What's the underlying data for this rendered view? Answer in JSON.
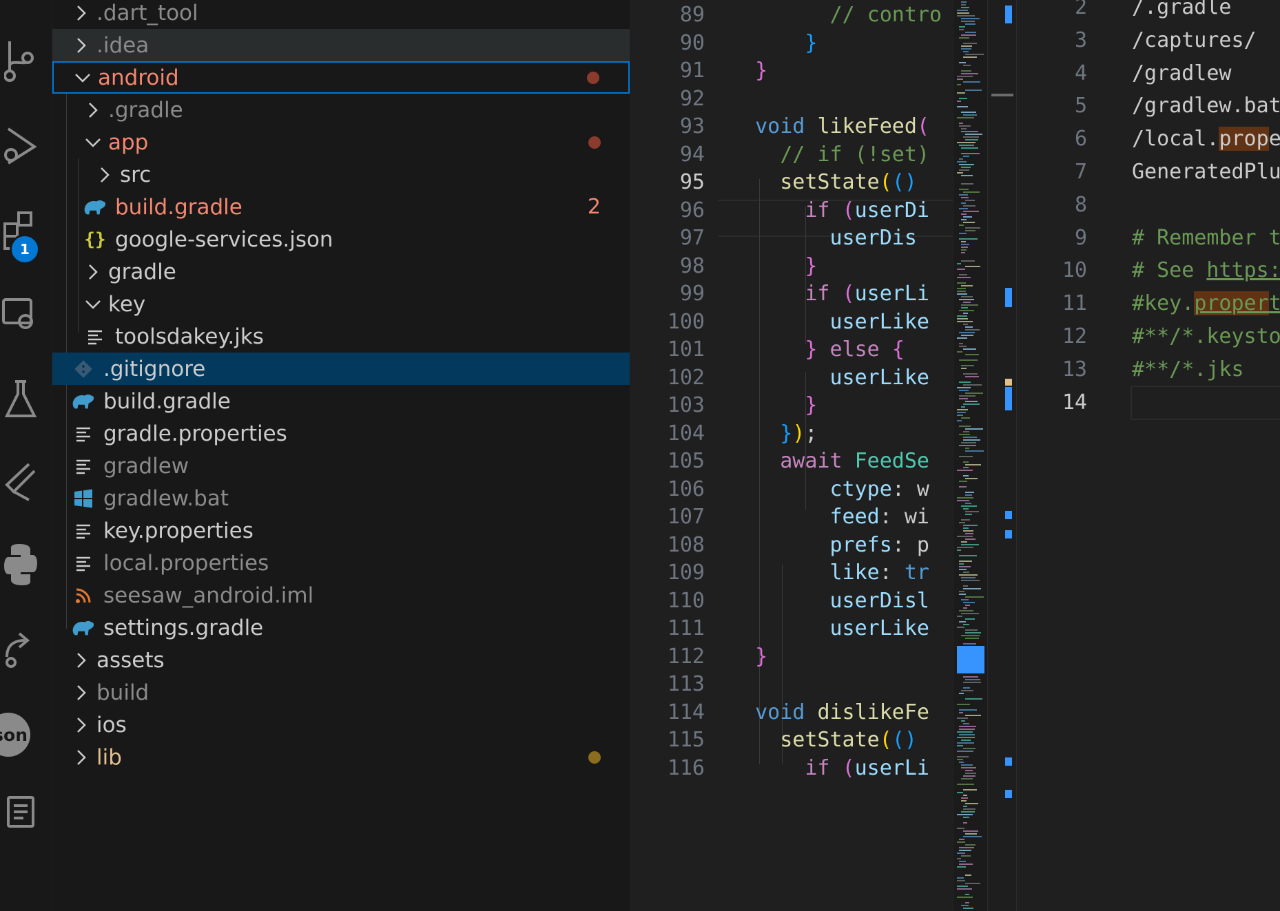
{
  "activity_bar": {
    "extensions_badge": "1",
    "json_badge": "son",
    "icons": [
      "source-control-icon",
      "run-debug-icon",
      "extensions-icon",
      "remote-explorer-icon",
      "testing-icon",
      "flutter-icon",
      "python-icon",
      "json-icon",
      "live-share-icon",
      "output-icon"
    ]
  },
  "explorer": {
    "items": [
      {
        "label": ".dart_tool",
        "chevron": "right",
        "style": "dim"
      },
      {
        "label": ".idea",
        "chevron": "right",
        "style": "dim"
      },
      {
        "label": "android",
        "chevron": "down",
        "style": "mod",
        "decoration": "dot"
      },
      {
        "label": ".gradle",
        "chevron": "right",
        "style": "dim"
      },
      {
        "label": "app",
        "chevron": "down",
        "style": "mod",
        "decoration": "dot"
      },
      {
        "label": "src",
        "chevron": "right",
        "style": "normal"
      },
      {
        "label": "build.gradle",
        "icon": "gradle-elephant-icon",
        "style": "mod",
        "decoration": "2"
      },
      {
        "label": "google-services.json",
        "icon": "json-braces-icon",
        "style": "normal"
      },
      {
        "label": "gradle",
        "chevron": "right",
        "style": "normal"
      },
      {
        "label": "key",
        "chevron": "down",
        "style": "normal"
      },
      {
        "label": "toolsdakey.jks",
        "icon": "lines-file-icon",
        "style": "normal"
      },
      {
        "label": ".gitignore",
        "icon": "git-icon",
        "style": "normal",
        "selected": true
      },
      {
        "label": "build.gradle",
        "icon": "gradle-elephant-icon",
        "style": "normal"
      },
      {
        "label": "gradle.properties",
        "icon": "lines-file-icon",
        "style": "normal"
      },
      {
        "label": "gradlew",
        "icon": "lines-file-icon",
        "style": "dim"
      },
      {
        "label": "gradlew.bat",
        "icon": "windows-icon",
        "style": "dim"
      },
      {
        "label": "key.properties",
        "icon": "lines-file-icon",
        "style": "normal"
      },
      {
        "label": "local.properties",
        "icon": "lines-file-icon",
        "style": "dim"
      },
      {
        "label": "seesaw_android.iml",
        "icon": "rss-icon",
        "style": "dim"
      },
      {
        "label": "settings.gradle",
        "icon": "gradle-elephant-icon",
        "style": "normal"
      },
      {
        "label": "assets",
        "chevron": "right",
        "style": "normal"
      },
      {
        "label": "build",
        "chevron": "right",
        "style": "dim"
      },
      {
        "label": "ios",
        "chevron": "right",
        "style": "normal"
      },
      {
        "label": "lib",
        "chevron": "right",
        "style": "yel",
        "decoration": "dot"
      }
    ]
  },
  "editor": {
    "line_numbers": [
      "89",
      "90",
      "91",
      "92",
      "93",
      "94",
      "95",
      "96",
      "97",
      "98",
      "99",
      "100",
      "101",
      "102",
      "103",
      "104",
      "105",
      "106",
      "107",
      "108",
      "109",
      "110",
      "111",
      "112",
      "113",
      "114",
      "115",
      "116"
    ],
    "current_line": "95",
    "lines": [
      [
        {
          "t": "        // contro",
          "c": "#6a9955"
        }
      ],
      [
        {
          "t": "      }",
          "c": "#179fff"
        }
      ],
      [
        {
          "t": "  }",
          "c": "#da70d6"
        }
      ],
      [
        {
          "t": "",
          "c": "#cccccc"
        }
      ],
      [
        {
          "t": "  void ",
          "c": "#569cd6"
        },
        {
          "t": "likeFeed",
          "c": "#dcdcaa"
        },
        {
          "t": "(",
          "c": "#da70d6"
        }
      ],
      [
        {
          "t": "    // if (!set",
          "c": "#6a9955"
        },
        {
          "t": ")",
          "c": "#6a9955"
        }
      ],
      [
        {
          "t": "    ",
          "c": "#cccccc"
        },
        {
          "t": "setState",
          "c": "#dcdcaa"
        },
        {
          "t": "(",
          "c": "#ffd700"
        },
        {
          "t": "()",
          "c": "#179fff"
        }
      ],
      [
        {
          "t": "      ",
          "c": "#cccccc"
        },
        {
          "t": "if ",
          "c": "#c586c0"
        },
        {
          "t": "(",
          "c": "#da70d6"
        },
        {
          "t": "userDi",
          "c": "#9cdcfe"
        }
      ],
      [
        {
          "t": "        ",
          "c": "#cccccc"
        },
        {
          "t": "userDis",
          "c": "#9cdcfe"
        }
      ],
      [
        {
          "t": "      }",
          "c": "#da70d6"
        }
      ],
      [
        {
          "t": "      ",
          "c": "#cccccc"
        },
        {
          "t": "if ",
          "c": "#c586c0"
        },
        {
          "t": "(",
          "c": "#da70d6"
        },
        {
          "t": "userLi",
          "c": "#9cdcfe"
        }
      ],
      [
        {
          "t": "        ",
          "c": "#cccccc"
        },
        {
          "t": "userLike",
          "c": "#9cdcfe"
        }
      ],
      [
        {
          "t": "      } ",
          "c": "#da70d6"
        },
        {
          "t": "else ",
          "c": "#c586c0"
        },
        {
          "t": "{",
          "c": "#da70d6"
        }
      ],
      [
        {
          "t": "        ",
          "c": "#cccccc"
        },
        {
          "t": "userLike",
          "c": "#9cdcfe"
        }
      ],
      [
        {
          "t": "      }",
          "c": "#da70d6"
        }
      ],
      [
        {
          "t": "    }",
          "c": "#179fff"
        },
        {
          "t": ")",
          "c": "#ffd700"
        },
        {
          "t": ";",
          "c": "#cccccc"
        }
      ],
      [
        {
          "t": "    ",
          "c": "#cccccc"
        },
        {
          "t": "await ",
          "c": "#c586c0"
        },
        {
          "t": "FeedSe",
          "c": "#4ec9b0"
        }
      ],
      [
        {
          "t": "        ",
          "c": "#cccccc"
        },
        {
          "t": "ctype",
          "c": "#9cdcfe"
        },
        {
          "t": ": w",
          "c": "#cccccc"
        }
      ],
      [
        {
          "t": "        ",
          "c": "#cccccc"
        },
        {
          "t": "feed",
          "c": "#9cdcfe"
        },
        {
          "t": ": wi",
          "c": "#cccccc"
        }
      ],
      [
        {
          "t": "        ",
          "c": "#cccccc"
        },
        {
          "t": "prefs",
          "c": "#9cdcfe"
        },
        {
          "t": ": p",
          "c": "#cccccc"
        }
      ],
      [
        {
          "t": "        ",
          "c": "#cccccc"
        },
        {
          "t": "like",
          "c": "#9cdcfe"
        },
        {
          "t": ": ",
          "c": "#cccccc"
        },
        {
          "t": "tr",
          "c": "#569cd6"
        }
      ],
      [
        {
          "t": "        ",
          "c": "#cccccc"
        },
        {
          "t": "userDisl",
          "c": "#9cdcfe"
        }
      ],
      [
        {
          "t": "        ",
          "c": "#cccccc"
        },
        {
          "t": "userLike",
          "c": "#9cdcfe"
        }
      ],
      [
        {
          "t": "  }",
          "c": "#da70d6"
        }
      ],
      [
        {
          "t": "",
          "c": "#cccccc"
        }
      ],
      [
        {
          "t": "  void ",
          "c": "#569cd6"
        },
        {
          "t": "dislikeFe",
          "c": "#dcdcaa"
        }
      ],
      [
        {
          "t": "    ",
          "c": "#cccccc"
        },
        {
          "t": "setState",
          "c": "#dcdcaa"
        },
        {
          "t": "(",
          "c": "#ffd700"
        },
        {
          "t": "()",
          "c": "#179fff"
        }
      ],
      [
        {
          "t": "      ",
          "c": "#cccccc"
        },
        {
          "t": "if ",
          "c": "#c586c0"
        },
        {
          "t": "(",
          "c": "#da70d6"
        },
        {
          "t": "userLi",
          "c": "#9cdcfe"
        }
      ]
    ]
  },
  "right_editor": {
    "line_numbers": [
      "2",
      "3",
      "4",
      "5",
      "6",
      "7",
      "8",
      "9",
      "10",
      "11",
      "12",
      "13",
      "14"
    ],
    "current_line": "14",
    "lines": [
      "/.gradle",
      "/captures/",
      "/gradlew",
      "/gradlew.bat",
      "/local.properties",
      "GeneratedPluginRegistrant.java",
      "",
      "# Remember to never publicly share your keystore.",
      "# See https://flutter.dev/docs/deployment/android",
      "#key.properties",
      "#**/*.keystore",
      "#**/*.jks",
      ""
    ]
  }
}
